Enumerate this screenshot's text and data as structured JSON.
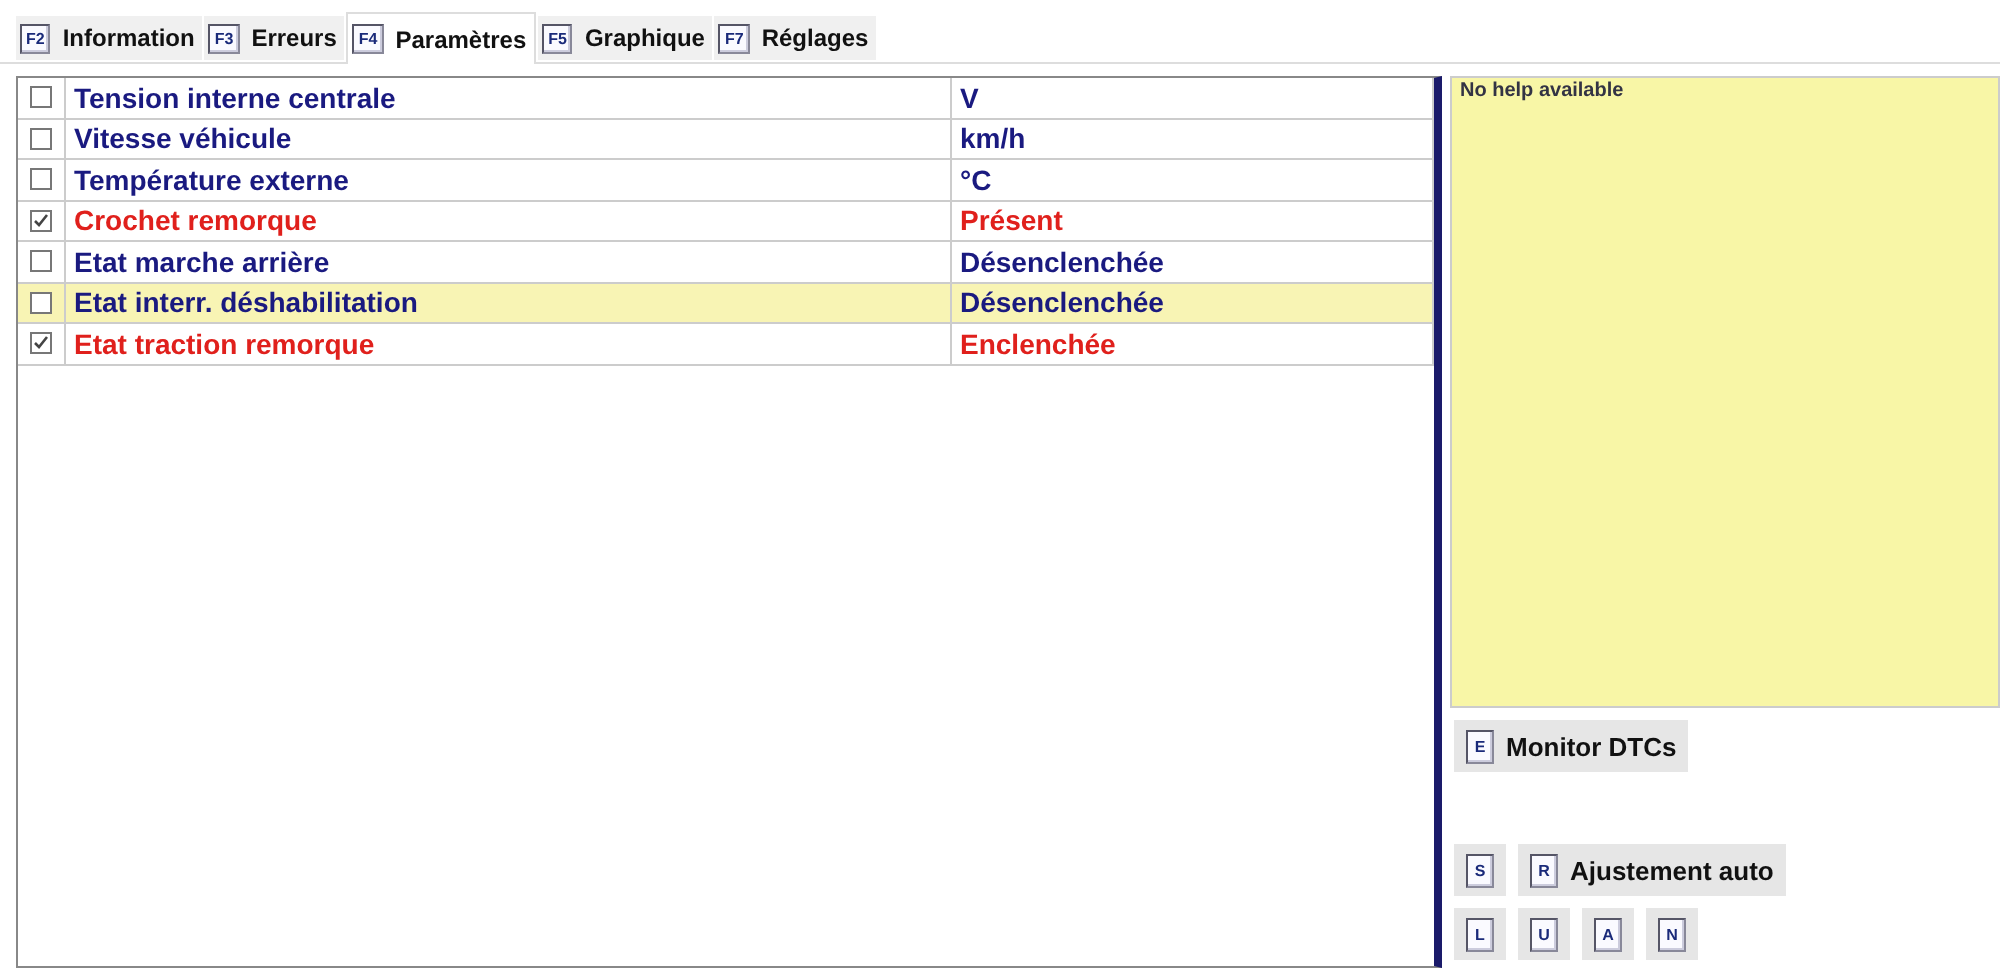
{
  "tabs": [
    {
      "key": "F2",
      "label": "Information",
      "selected": false
    },
    {
      "key": "F3",
      "label": "Erreurs",
      "selected": false
    },
    {
      "key": "F4",
      "label": "Paramètres",
      "selected": true
    },
    {
      "key": "F5",
      "label": "Graphique",
      "selected": false
    },
    {
      "key": "F7",
      "label": "Réglages",
      "selected": false
    }
  ],
  "parameters": [
    {
      "name": "Tension interne centrale",
      "value": "V",
      "checked": false,
      "selected": false
    },
    {
      "name": "Vitesse véhicule",
      "value": "km/h",
      "checked": false,
      "selected": false
    },
    {
      "name": "Température externe",
      "value": "°C",
      "checked": false,
      "selected": false
    },
    {
      "name": "Crochet remorque",
      "value": "Présent",
      "checked": true,
      "selected": false
    },
    {
      "name": "Etat marche arrière",
      "value": "Désenclenchée",
      "checked": false,
      "selected": false
    },
    {
      "name": "Etat interr. déshabilitation",
      "value": "Désenclenchée",
      "checked": false,
      "selected": true
    },
    {
      "name": "Etat traction remorque",
      "value": "Enclenchée",
      "checked": true,
      "selected": false
    }
  ],
  "help": {
    "text": "No help available"
  },
  "monitor_button": {
    "key": "E",
    "label": "Monitor DTCs"
  },
  "adjust_row": [
    {
      "key": "S"
    },
    {
      "key": "R",
      "label": "Ajustement auto"
    }
  ],
  "key_row": [
    {
      "key": "L"
    },
    {
      "key": "U"
    },
    {
      "key": "A"
    },
    {
      "key": "N"
    }
  ]
}
